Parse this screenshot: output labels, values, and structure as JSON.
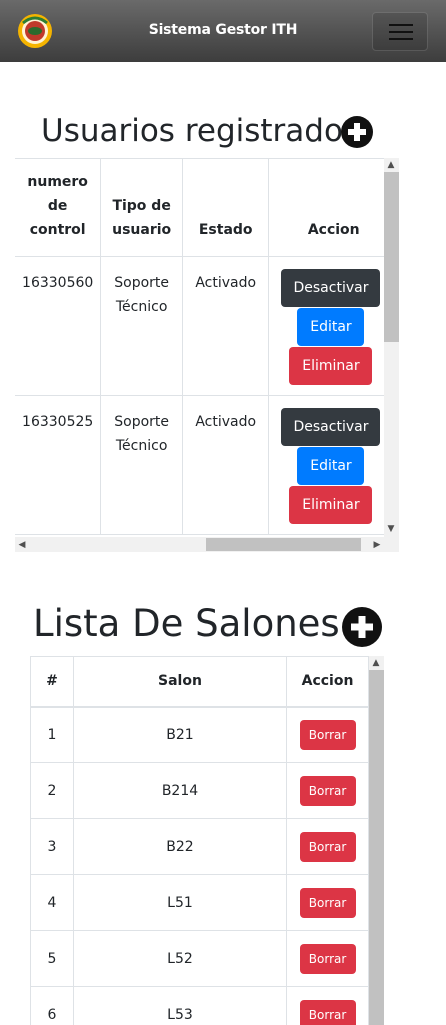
{
  "navbar": {
    "brand": "Sistema Gestor ITH",
    "logo_icon": "institution-logo",
    "menu_icon": "hamburger-icon"
  },
  "usuarios": {
    "title": "Usuarios registrados",
    "add_icon": "plus-circle-icon",
    "columns": [
      "numero de control",
      "Tipo de usuario",
      "Estado",
      "Accion"
    ],
    "rows": [
      {
        "control": "16330560",
        "tipo": "Soporte Técnico",
        "estado": "Activado"
      },
      {
        "control": "16330525",
        "tipo": "Soporte Técnico",
        "estado": "Activado"
      }
    ],
    "actions": {
      "deactivate": "Desactivar",
      "edit": "Editar",
      "delete": "Eliminar"
    }
  },
  "salones": {
    "title": "Lista De Salones",
    "add_icon": "plus-circle-icon",
    "columns": [
      "#",
      "Salon",
      "Accion"
    ],
    "rows": [
      {
        "num": "1",
        "salon": "B21"
      },
      {
        "num": "2",
        "salon": "B214"
      },
      {
        "num": "3",
        "salon": "B22"
      },
      {
        "num": "4",
        "salon": "L51"
      },
      {
        "num": "5",
        "salon": "L52"
      },
      {
        "num": "6",
        "salon": "L53"
      }
    ],
    "delete_label": "Borrar"
  },
  "colors": {
    "navbar": "#4a4a4a",
    "dark": "#343a40",
    "primary": "#007bff",
    "danger": "#dc3545"
  }
}
